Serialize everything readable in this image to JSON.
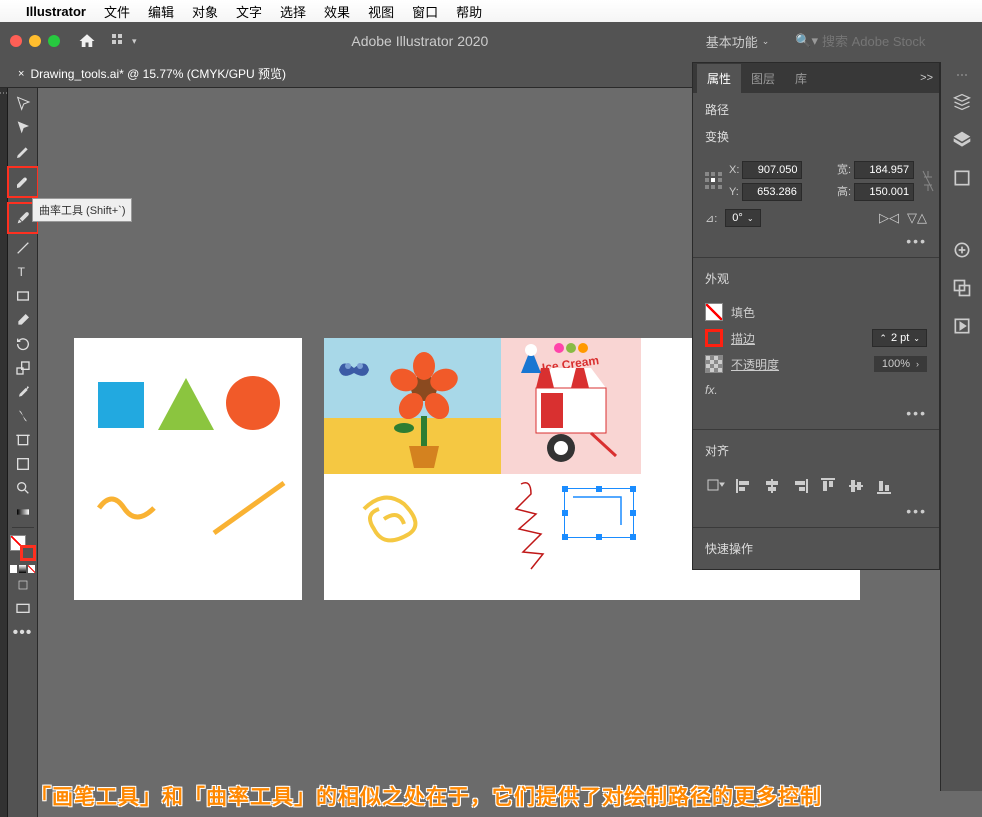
{
  "menubar": {
    "app": "Illustrator",
    "items": [
      "文件",
      "编辑",
      "对象",
      "文字",
      "选择",
      "效果",
      "视图",
      "窗口",
      "帮助"
    ]
  },
  "titlebar": {
    "app_title": "Adobe Illustrator 2020",
    "workspace": "基本功能",
    "search_placeholder": "搜索 Adobe Stock"
  },
  "doc_tab": {
    "label": "Drawing_tools.ai* @ 15.77% (CMYK/GPU 预览)"
  },
  "tooltip": "曲率工具 (Shift+`)",
  "panel": {
    "tabs": [
      "属性",
      "图层",
      "库"
    ],
    "path_label": "路径",
    "transform_label": "变换",
    "x_label": "X:",
    "x_val": "907.050",
    "y_label": "Y:",
    "y_val": "653.286",
    "w_label": "宽:",
    "w_val": "184.957",
    "h_label": "高:",
    "h_val": "150.001",
    "angle_label": "⊿:",
    "angle_val": "0°",
    "appearance_label": "外观",
    "fill_label": "填色",
    "stroke_label": "描边",
    "stroke_val": "2 pt",
    "opacity_label": "不透明度",
    "opacity_val": "100%",
    "fx_label": "fx.",
    "align_label": "对齐",
    "quick_label": "快速操作"
  },
  "caption": "「画笔工具」和「曲率工具」的相似之处在于，它们提供了对绘制路径的更多控制"
}
